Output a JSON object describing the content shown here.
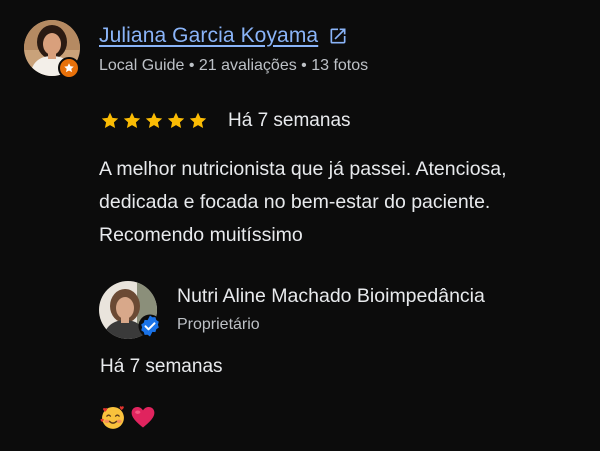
{
  "review": {
    "reviewer": {
      "name": "Juliana Garcia Koyama",
      "meta": "Local Guide • 21 avaliações • 13 fotos",
      "avatar_icon": "reviewer-profile-photo",
      "badge_icon": "local-guide-star-badge"
    },
    "rating": {
      "stars": 5,
      "max_stars": 5,
      "star_color": "#fbbc04"
    },
    "date": "Há 7 semanas",
    "text": "A melhor nutricionista que já passei. Atenciosa, dedicada e focada no bem-estar do paciente. Recomendo muitíssimo"
  },
  "owner_reply": {
    "name": "Nutri Aline Machado Bioimpedância",
    "role": "Proprietário",
    "date": "Há 7 semanas",
    "text": "🥰❤️",
    "avatar_icon": "owner-profile-photo",
    "badge_icon": "verified-check-badge"
  },
  "colors": {
    "background": "#0c0c0c",
    "link": "#8ab4f8",
    "text_primary": "#e8eaed",
    "text_secondary": "#bdc1c6",
    "guide_badge": "#e8710a",
    "verified_badge": "#1a73e8"
  }
}
